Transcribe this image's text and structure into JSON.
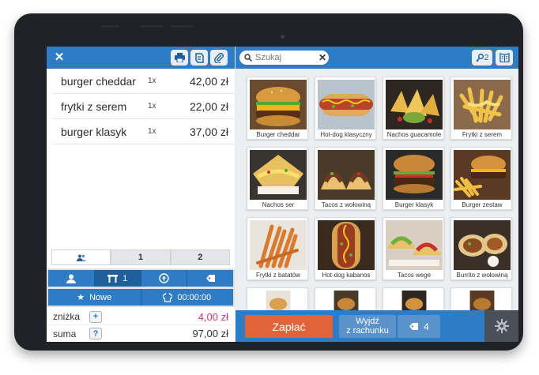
{
  "order": {
    "items": [
      {
        "name": "burger cheddar",
        "qty": "1x",
        "price": "42,00 zł"
      },
      {
        "name": "frytki z serem",
        "qty": "1x",
        "price": "22,00 zł"
      },
      {
        "name": "burger klasyk",
        "qty": "1x",
        "price": "37,00 zł"
      }
    ]
  },
  "tabs": [
    {
      "label": ""
    },
    {
      "label": "1"
    },
    {
      "label": "2"
    }
  ],
  "info": {
    "table_label": "1",
    "new_label": "Nowe",
    "time": "00:00:00"
  },
  "totals": {
    "discount_label": "zniżka",
    "discount_btn": "+",
    "discount_value": "4,00 zł",
    "sum_label": "suma",
    "sum_btn": "?",
    "sum_value": "97,00 zł"
  },
  "search": {
    "placeholder": "Szukaj",
    "value": "Szukaj"
  },
  "key_count": "2",
  "products": [
    {
      "label": "Burger cheddar"
    },
    {
      "label": "Hot-dog klasyczny"
    },
    {
      "label": "Nachos guacamole"
    },
    {
      "label": "Frytki z serem"
    },
    {
      "label": "Nachos ser"
    },
    {
      "label": "Tacos z wołowiną"
    },
    {
      "label": "Burger klasyk"
    },
    {
      "label": "Burger zestaw"
    },
    {
      "label": "Frytki z batatów"
    },
    {
      "label": "Hot-dog kabanos"
    },
    {
      "label": "Tacos wege"
    },
    {
      "label": "Burrito z wołowiną"
    }
  ],
  "bottom": {
    "pay_label": "Zapłać",
    "exit_line1": "Wyjdź",
    "exit_line2": "z rachunku",
    "tag_count": "4"
  },
  "colors": {
    "primary": "#2f7cc6",
    "pay": "#e0633a",
    "discount": "#d4307a"
  }
}
